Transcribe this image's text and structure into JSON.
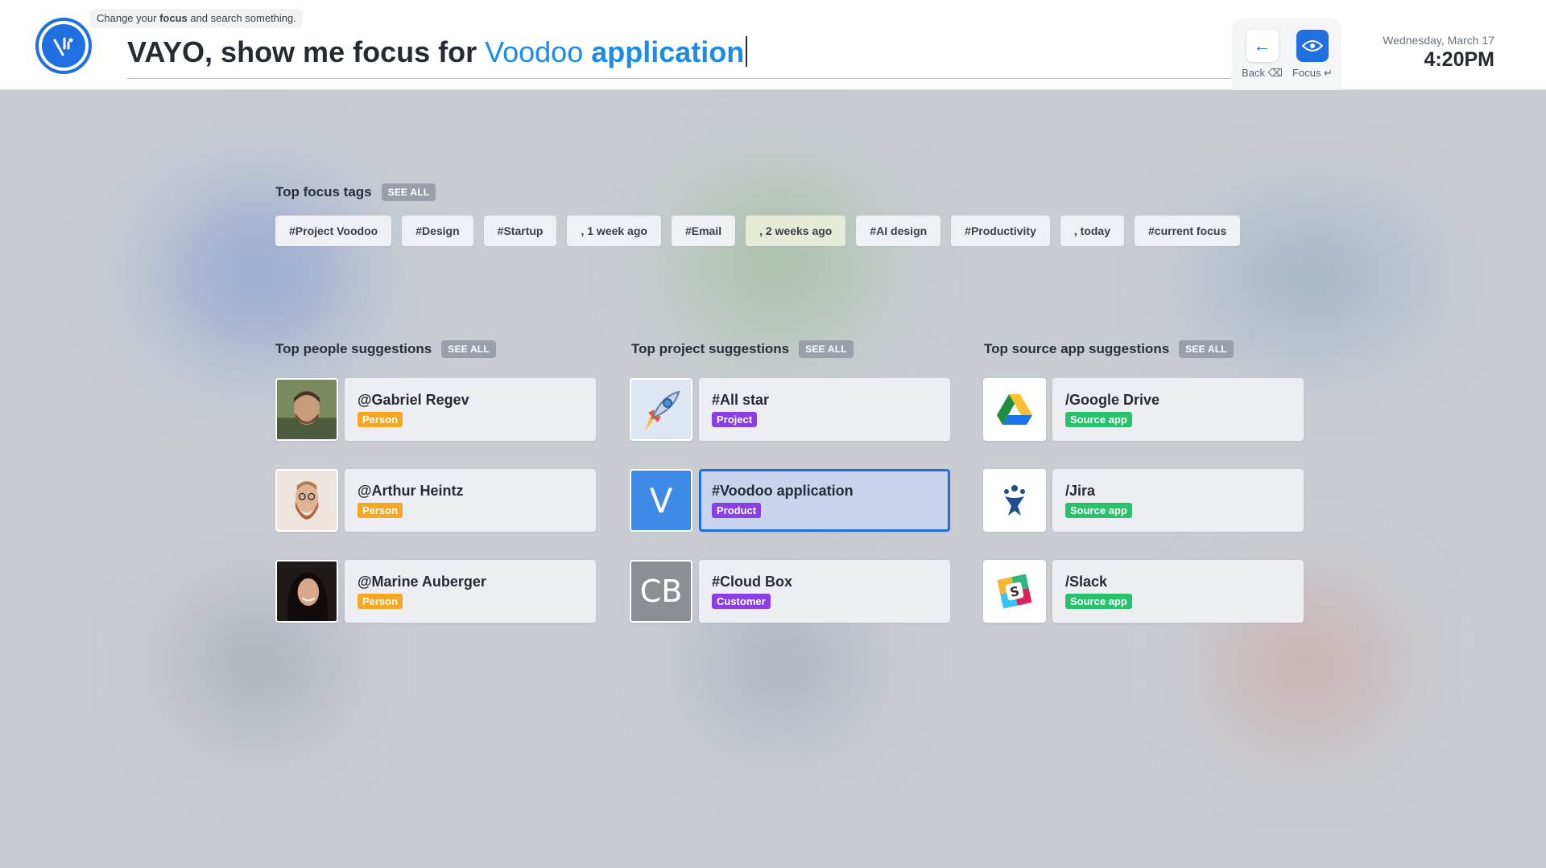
{
  "header": {
    "hint_prefix": "Change your ",
    "hint_bold": "focus",
    "hint_suffix": " and search something.",
    "query_prefix": "VAYO, show me focus for ",
    "query_light": "Voodoo",
    "query_strong": "application",
    "back_label": "Back ⌫",
    "focus_label": "Focus ↵",
    "date": "Wednesday, March 17",
    "time": "4:20PM"
  },
  "tags_section": {
    "title": "Top focus tags",
    "see_all": "SEE ALL",
    "tags": [
      "#Project Voodoo",
      "#Design",
      "#Startup",
      ", 1 week ago",
      "#Email",
      ", 2 weeks ago",
      "#AI design",
      "#Productivity",
      ", today",
      "#current focus"
    ]
  },
  "people": {
    "title": "Top people suggestions",
    "see_all": "SEE ALL",
    "items": [
      {
        "name": "@Gabriel Regev",
        "badge": "Person"
      },
      {
        "name": "@Arthur Heintz",
        "badge": "Person"
      },
      {
        "name": "@Marine Auberger",
        "badge": "Person"
      }
    ]
  },
  "projects": {
    "title": "Top project suggestions",
    "see_all": "SEE ALL",
    "items": [
      {
        "name": "#All star",
        "badge": "Project",
        "tile": ""
      },
      {
        "name": "#Voodoo application",
        "badge": "Product",
        "tile": "V"
      },
      {
        "name": "#Cloud Box",
        "badge": "Customer",
        "tile": "CB"
      }
    ]
  },
  "apps": {
    "title": "Top source app suggestions",
    "see_all": "SEE ALL",
    "items": [
      {
        "name": "/Google Drive",
        "badge": "Source app",
        "icon": "google-drive-icon"
      },
      {
        "name": "/Jira",
        "badge": "Source app",
        "icon": "jira-icon"
      },
      {
        "name": "/Slack",
        "badge": "Source app",
        "icon": "slack-icon"
      }
    ]
  },
  "colors": {
    "accent": "#1f6fe0",
    "person": "#f5a623",
    "project": "#8a3ee6",
    "source_app": "#27c26b"
  }
}
